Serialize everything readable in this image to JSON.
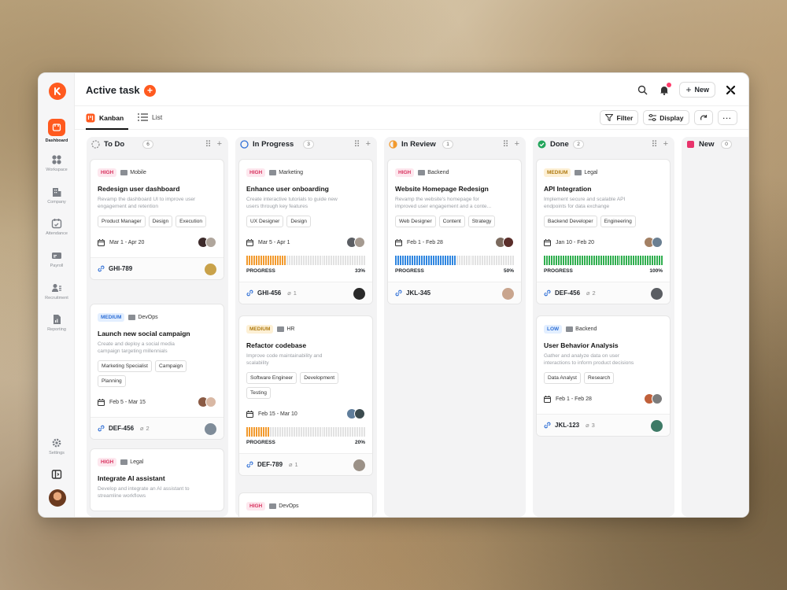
{
  "app": {
    "title": "Active task",
    "new_label": "New"
  },
  "sidebar": {
    "items": [
      {
        "label": "Dashboard",
        "icon": "dashboard-icon"
      },
      {
        "label": "Workspace",
        "icon": "grid-icon"
      },
      {
        "label": "Company",
        "icon": "building-icon"
      },
      {
        "label": "Attendance",
        "icon": "calendar-icon"
      },
      {
        "label": "Payroll",
        "icon": "money-icon"
      },
      {
        "label": "Recruitment",
        "icon": "user-list-icon"
      },
      {
        "label": "Reporting",
        "icon": "report-icon"
      },
      {
        "label": "Settings",
        "icon": "gear-icon"
      }
    ]
  },
  "views": {
    "kanban": "Kanban",
    "list": "List"
  },
  "toolbar": {
    "filter": "Filter",
    "display": "Display"
  },
  "colors": {
    "accent": "#ff5a1f",
    "high": "#d8335f",
    "medium": "#b07b12",
    "low": "#2f6fd6"
  },
  "columns": [
    {
      "name": "To Do",
      "count": "6",
      "cards": [
        {
          "priority": "HIGH",
          "category": "Mobile",
          "title": "Redesign user dashboard",
          "desc1": "Revamp the dashboard UI to improve user",
          "desc2": "engagement and retention",
          "chips": [
            "Product Manager",
            "Design",
            "Execution"
          ],
          "date": "Mar 1 - Apr 20",
          "id": "GHI-789"
        },
        {
          "priority": "MEDIUM",
          "category": "DevOps",
          "title": "Launch new social campaign",
          "desc1": "Create and deploy a social media",
          "desc2": "campaign targeting millennials",
          "chips": [
            "Marketing Specialist",
            "Campaign",
            "Planning"
          ],
          "date": "Feb 5 - Mar 15",
          "id": "DEF-456",
          "attachments": "2"
        },
        {
          "priority": "HIGH",
          "category": "Legal",
          "title": "Integrate AI assistant",
          "desc1": "Develop and integrate an AI assistant to",
          "desc2": "streamline workflows"
        }
      ]
    },
    {
      "name": "In Progress",
      "count": "3",
      "cards": [
        {
          "priority": "HIGH",
          "category": "Marketing",
          "title": "Enhance user onboarding",
          "desc1": "Create interactive tutorials to guide new",
          "desc2": "users through key features",
          "chips": [
            "UX Designer",
            "Design"
          ],
          "date": "Mar 5 - Apr 1",
          "progress_label": "PROGRESS",
          "progress": "33%",
          "id": "GHI-456",
          "attachments": "1"
        },
        {
          "priority": "MEDIUM",
          "category": "HR",
          "title": "Refactor codebase",
          "desc1": "Improve code maintainability and",
          "desc2": "scalability",
          "chips": [
            "Software Engineer",
            "Development",
            "Testing"
          ],
          "date": "Feb 15 - Mar 10",
          "progress_label": "PROGRESS",
          "progress": "20%",
          "id": "DEF-789",
          "attachments": "1"
        },
        {
          "priority": "HIGH",
          "category": "DevOps"
        }
      ]
    },
    {
      "name": "In Review",
      "count": "1",
      "cards": [
        {
          "priority": "HIGH",
          "category": "Backend",
          "title": "Website Homepage Redesign",
          "desc1": "Revamp the website's homepage for",
          "desc2": "improved user engagement and a conte...",
          "chips": [
            "Web Designer",
            "Content",
            "Strategy"
          ],
          "date": "Feb 1 - Feb 28",
          "progress_label": "PROGRESS",
          "progress": "50%",
          "id": "JKL-345"
        }
      ]
    },
    {
      "name": "Done",
      "count": "2",
      "cards": [
        {
          "priority": "MEDIUM",
          "category": "Legal",
          "title": "API Integration",
          "desc1": "Implement secure and scalable API",
          "desc2": "endpoints for data exchange",
          "chips": [
            "Backend Developer",
            "Engineering"
          ],
          "date": "Jan 10 - Feb 20",
          "progress_label": "PROGRESS",
          "progress": "100%",
          "id": "DEF-456",
          "attachments": "2"
        },
        {
          "priority": "LOW",
          "category": "Backend",
          "title": "User Behavior Analysis",
          "desc1": "Gather and analyze data on user",
          "desc2": "interactions to inform product decisions",
          "chips": [
            "Data Analyst",
            "Research"
          ],
          "date": "Feb 1 - Feb 28",
          "id": "JKL-123",
          "attachments": "3"
        }
      ]
    },
    {
      "name": "New",
      "count": "0",
      "cards": []
    }
  ]
}
